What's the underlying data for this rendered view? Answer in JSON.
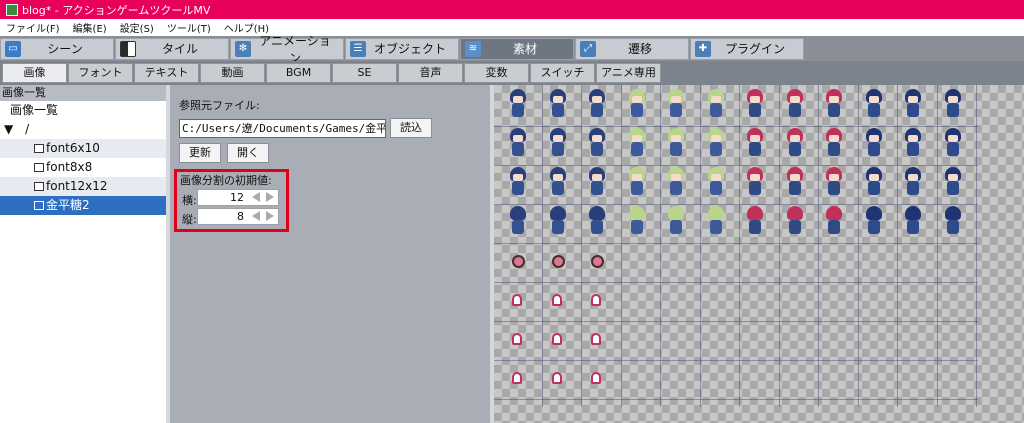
{
  "window": {
    "title": "blog* - アクションゲームツクールMV"
  },
  "menu": [
    "ファイル(F)",
    "編集(E)",
    "設定(S)",
    "ツール(T)",
    "ヘルプ(H)"
  ],
  "main_tabs": [
    {
      "label": "シーン",
      "icon": "scene-icon"
    },
    {
      "label": "タイル",
      "icon": "tile-icon"
    },
    {
      "label": "アニメーション",
      "icon": "animation-icon"
    },
    {
      "label": "オブジェクト",
      "icon": "object-icon"
    },
    {
      "label": "素材",
      "icon": "resource-icon",
      "active": true
    },
    {
      "label": "遷移",
      "icon": "transition-icon"
    },
    {
      "label": "プラグイン",
      "icon": "plugin-icon"
    }
  ],
  "sub_tabs": [
    "画像",
    "フォント",
    "テキスト",
    "動画",
    "BGM",
    "SE",
    "音声",
    "変数",
    "スイッチ",
    "アニメ専用"
  ],
  "sub_tab_active": "画像",
  "left_panel": {
    "header": "画像一覧",
    "root": "画像一覧",
    "folder": "/",
    "folder_toggle": "▼",
    "files": [
      "font6x10",
      "font8x8",
      "font12x12",
      "金平糖2"
    ],
    "selected": "金平糖2"
  },
  "properties": {
    "ref_file_label": "参照元ファイル:",
    "ref_file_value": "C:/Users/遼/Documents/Games/金平糖/",
    "load_button": "読込",
    "refresh_button": "更新",
    "open_button": "開く",
    "division_label": "画像分割の初期値:",
    "horizontal_label": "横:",
    "horizontal_value": "12",
    "vertical_label": "縦:",
    "vertical_value": "8"
  },
  "colors": {
    "title_bar": "#e8005a",
    "selection": "#2c6fc1",
    "highlight": "#e3001b"
  }
}
